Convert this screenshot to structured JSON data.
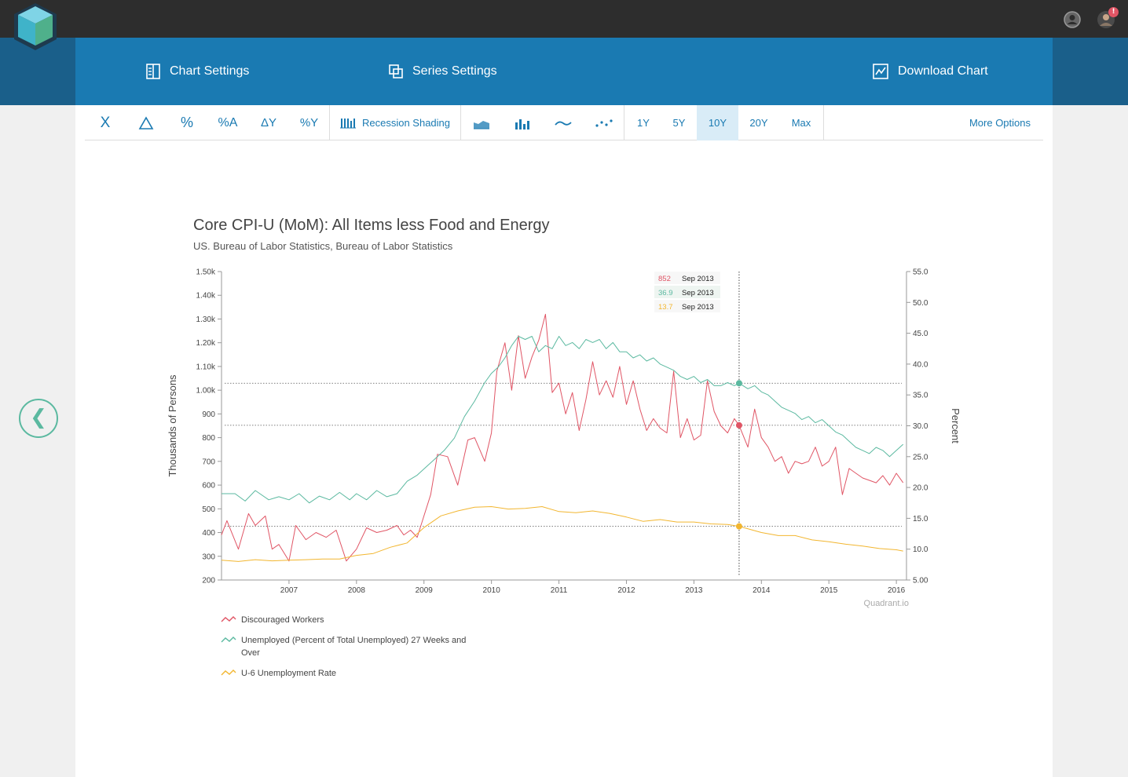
{
  "header": {
    "nav": {
      "chart_settings": "Chart Settings",
      "series_settings": "Series Settings",
      "download_chart": "Download Chart"
    },
    "notification_count": "!"
  },
  "toolbar": {
    "transforms": [
      "X",
      "Δ",
      "%",
      "%A",
      "ΔY",
      "%Y"
    ],
    "recession_shading": "Recession Shading",
    "periods": [
      "1Y",
      "5Y",
      "10Y",
      "20Y",
      "Max"
    ],
    "active_period": "10Y",
    "more_options": "More Options"
  },
  "chart": {
    "title": "Core CPI-U (MoM): All Items less Food and Energy",
    "subtitle": "US. Bureau of Labor Statistics, Bureau of Labor Statistics",
    "watermark": "Quadrant.io",
    "tooltip": [
      {
        "value": "852",
        "date": "Sep 2013",
        "color": "#e05565"
      },
      {
        "value": "36.9",
        "date": "Sep 2013",
        "color": "#5bb9a0"
      },
      {
        "value": "13.7",
        "date": "Sep 2013",
        "color": "#f2b630"
      }
    ]
  },
  "legend": [
    {
      "label": "Discouraged Workers",
      "color": "#e05565"
    },
    {
      "label": "Unemployed (Percent of Total Unemployed) 27 Weeks and Over",
      "color": "#5bb9a0"
    },
    {
      "label": "U-6 Unemployment Rate",
      "color": "#f2b630"
    }
  ],
  "chart_data": {
    "type": "line",
    "title": "Core CPI-U (MoM): All Items less Food and Energy",
    "subtitle": "US. Bureau of Labor Statistics, Bureau of Labor Statistics",
    "ylabel": "Thousands of Persons",
    "y2label": "Percent",
    "xlim": [
      2006.0,
      2016.15
    ],
    "ylim": [
      200,
      1500
    ],
    "y2lim": [
      5,
      55
    ],
    "x_ticks": [
      "2007",
      "2008",
      "2009",
      "2010",
      "2011",
      "2012",
      "2013",
      "2014",
      "2015",
      "2016"
    ],
    "y_ticks": [
      "200",
      "300",
      "400",
      "500",
      "600",
      "700",
      "800",
      "900",
      "1.00k",
      "1.10k",
      "1.20k",
      "1.30k",
      "1.40k",
      "1.50k"
    ],
    "y2_ticks": [
      "5.00",
      "10.0",
      "15.0",
      "20.0",
      "25.0",
      "30.0",
      "35.0",
      "40.0",
      "45.0",
      "50.0",
      "55.0"
    ],
    "grid": false,
    "legend_position": "bottom-left",
    "crosshair_x": 2013.67,
    "series": [
      {
        "name": "Discouraged Workers",
        "axis": "left",
        "color": "#e05565",
        "x": [
          2006.0,
          2006.08,
          2006.25,
          2006.4,
          2006.5,
          2006.65,
          2006.75,
          2006.85,
          2007.0,
          2007.1,
          2007.25,
          2007.4,
          2007.55,
          2007.7,
          2007.85,
          2008.0,
          2008.15,
          2008.3,
          2008.45,
          2008.6,
          2008.7,
          2008.8,
          2008.9,
          2009.0,
          2009.1,
          2009.2,
          2009.35,
          2009.5,
          2009.65,
          2009.75,
          2009.9,
          2010.0,
          2010.08,
          2010.2,
          2010.3,
          2010.4,
          2010.5,
          2010.6,
          2010.7,
          2010.8,
          2010.9,
          2011.0,
          2011.1,
          2011.2,
          2011.3,
          2011.4,
          2011.5,
          2011.6,
          2011.7,
          2011.8,
          2011.9,
          2012.0,
          2012.1,
          2012.2,
          2012.3,
          2012.4,
          2012.5,
          2012.6,
          2012.7,
          2012.8,
          2012.9,
          2013.0,
          2013.1,
          2013.2,
          2013.3,
          2013.4,
          2013.5,
          2013.6,
          2013.67,
          2013.8,
          2013.9,
          2014.0,
          2014.1,
          2014.2,
          2014.3,
          2014.4,
          2014.5,
          2014.6,
          2014.7,
          2014.8,
          2014.9,
          2015.0,
          2015.1,
          2015.2,
          2015.3,
          2015.4,
          2015.5,
          2015.6,
          2015.7,
          2015.8,
          2015.9,
          2016.0,
          2016.1
        ],
        "values": [
          390,
          450,
          330,
          480,
          430,
          470,
          330,
          350,
          280,
          430,
          370,
          400,
          380,
          410,
          280,
          330,
          420,
          400,
          410,
          430,
          390,
          410,
          380,
          470,
          560,
          730,
          720,
          600,
          790,
          800,
          700,
          820,
          1080,
          1200,
          1000,
          1230,
          1050,
          1140,
          1210,
          1320,
          990,
          1030,
          900,
          990,
          830,
          960,
          1120,
          980,
          1040,
          970,
          1100,
          940,
          1040,
          920,
          830,
          880,
          840,
          820,
          1080,
          800,
          880,
          790,
          810,
          1040,
          910,
          850,
          820,
          880,
          852,
          760,
          920,
          800,
          760,
          700,
          720,
          650,
          700,
          690,
          700,
          760,
          680,
          700,
          760,
          560,
          670,
          650,
          630,
          620,
          610,
          640,
          600,
          650,
          610
        ],
        "note": "approximate"
      },
      {
        "name": "Unemployed (Percent of Total Unemployed) 27 Weeks and Over",
        "axis": "right",
        "color": "#5bb9a0",
        "x": [
          2006.0,
          2006.2,
          2006.35,
          2006.5,
          2006.7,
          2006.85,
          2007.0,
          2007.15,
          2007.3,
          2007.45,
          2007.6,
          2007.75,
          2007.9,
          2008.0,
          2008.15,
          2008.3,
          2008.45,
          2008.6,
          2008.75,
          2008.9,
          2009.0,
          2009.15,
          2009.3,
          2009.45,
          2009.6,
          2009.75,
          2009.9,
          2010.0,
          2010.1,
          2010.2,
          2010.3,
          2010.4,
          2010.5,
          2010.6,
          2010.7,
          2010.8,
          2010.9,
          2011.0,
          2011.1,
          2011.2,
          2011.3,
          2011.4,
          2011.5,
          2011.6,
          2011.7,
          2011.8,
          2011.9,
          2012.0,
          2012.1,
          2012.2,
          2012.3,
          2012.4,
          2012.5,
          2012.6,
          2012.7,
          2012.8,
          2012.9,
          2013.0,
          2013.1,
          2013.2,
          2013.3,
          2013.4,
          2013.5,
          2013.6,
          2013.67,
          2013.8,
          2013.9,
          2014.0,
          2014.1,
          2014.2,
          2014.3,
          2014.4,
          2014.5,
          2014.6,
          2014.7,
          2014.8,
          2014.9,
          2015.0,
          2015.1,
          2015.2,
          2015.3,
          2015.4,
          2015.5,
          2015.6,
          2015.7,
          2015.8,
          2015.9,
          2016.0,
          2016.1
        ],
        "values": [
          19.0,
          19.0,
          17.8,
          19.5,
          18.0,
          18.5,
          18.0,
          19.0,
          17.5,
          18.6,
          18.0,
          19.2,
          18.0,
          19.0,
          18.0,
          19.5,
          18.5,
          19.0,
          21.0,
          22.0,
          23.0,
          24.5,
          26.0,
          28.0,
          31.5,
          34.0,
          37.0,
          38.5,
          39.5,
          41.0,
          43.0,
          44.5,
          44.0,
          44.5,
          42.0,
          43.0,
          42.5,
          44.5,
          43.0,
          43.5,
          42.5,
          44.0,
          43.5,
          44.0,
          42.5,
          43.5,
          42.0,
          42.0,
          41.0,
          41.5,
          40.5,
          41.0,
          40.0,
          39.5,
          39.0,
          38.0,
          37.5,
          38.0,
          37.0,
          37.5,
          36.5,
          36.5,
          37.0,
          36.5,
          36.9,
          36.0,
          36.5,
          35.5,
          35.0,
          34.0,
          33.0,
          32.5,
          32.0,
          31.0,
          31.5,
          30.5,
          31.0,
          30.0,
          29.0,
          28.5,
          27.5,
          26.5,
          26.0,
          25.5,
          26.5,
          26.0,
          25.0,
          26.0,
          27.0
        ],
        "note": "approximate"
      },
      {
        "name": "U-6 Unemployment Rate",
        "axis": "right",
        "color": "#f2b630",
        "x": [
          2006.0,
          2006.25,
          2006.5,
          2006.75,
          2007.0,
          2007.25,
          2007.5,
          2007.75,
          2008.0,
          2008.25,
          2008.5,
          2008.75,
          2009.0,
          2009.25,
          2009.5,
          2009.75,
          2010.0,
          2010.25,
          2010.5,
          2010.75,
          2011.0,
          2011.25,
          2011.5,
          2011.75,
          2012.0,
          2012.25,
          2012.5,
          2012.75,
          2013.0,
          2013.25,
          2013.5,
          2013.67,
          2014.0,
          2014.25,
          2014.5,
          2014.75,
          2015.0,
          2015.25,
          2015.5,
          2015.75,
          2016.0,
          2016.1
        ],
        "values": [
          8.2,
          8.0,
          8.3,
          8.1,
          8.2,
          8.3,
          8.4,
          8.4,
          9.0,
          9.3,
          10.3,
          11.0,
          13.5,
          15.4,
          16.2,
          16.8,
          16.9,
          16.5,
          16.6,
          16.9,
          16.1,
          15.9,
          16.2,
          15.8,
          15.2,
          14.5,
          14.8,
          14.4,
          14.4,
          14.1,
          14.0,
          13.7,
          12.7,
          12.2,
          12.2,
          11.5,
          11.2,
          10.8,
          10.5,
          10.1,
          9.9,
          9.7
        ],
        "note": "approximate"
      }
    ]
  }
}
